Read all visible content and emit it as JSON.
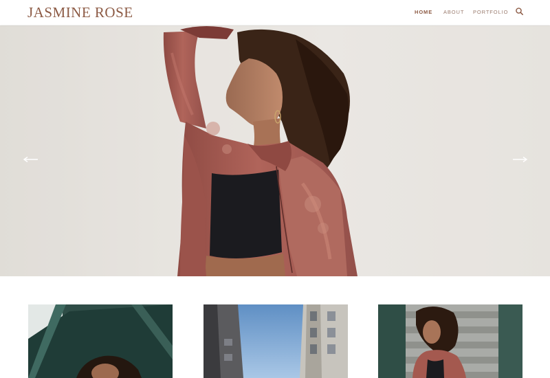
{
  "site": {
    "logo": "JASMINE ROSE"
  },
  "nav": {
    "items": [
      {
        "label": "HOME",
        "active": true
      },
      {
        "label": "ABOUT",
        "active": false
      },
      {
        "label": "PORTFOLIO",
        "active": false
      }
    ],
    "search_icon": "search-icon"
  },
  "hero": {
    "slide_image": "woman in rose satin bomber jacket against white wall",
    "prev_icon": "arrow-left-icon",
    "next_icon": "arrow-right-icon"
  },
  "gallery": {
    "items": [
      {
        "image": "woman on green staircase"
      },
      {
        "image": "street between buildings with sky"
      },
      {
        "image": "woman on concrete stairs"
      }
    ]
  },
  "colors": {
    "brand": "#8c5a44",
    "nav_text": "#9a7b6e",
    "jacket": "#a55a4f",
    "background": "#ffffff"
  }
}
